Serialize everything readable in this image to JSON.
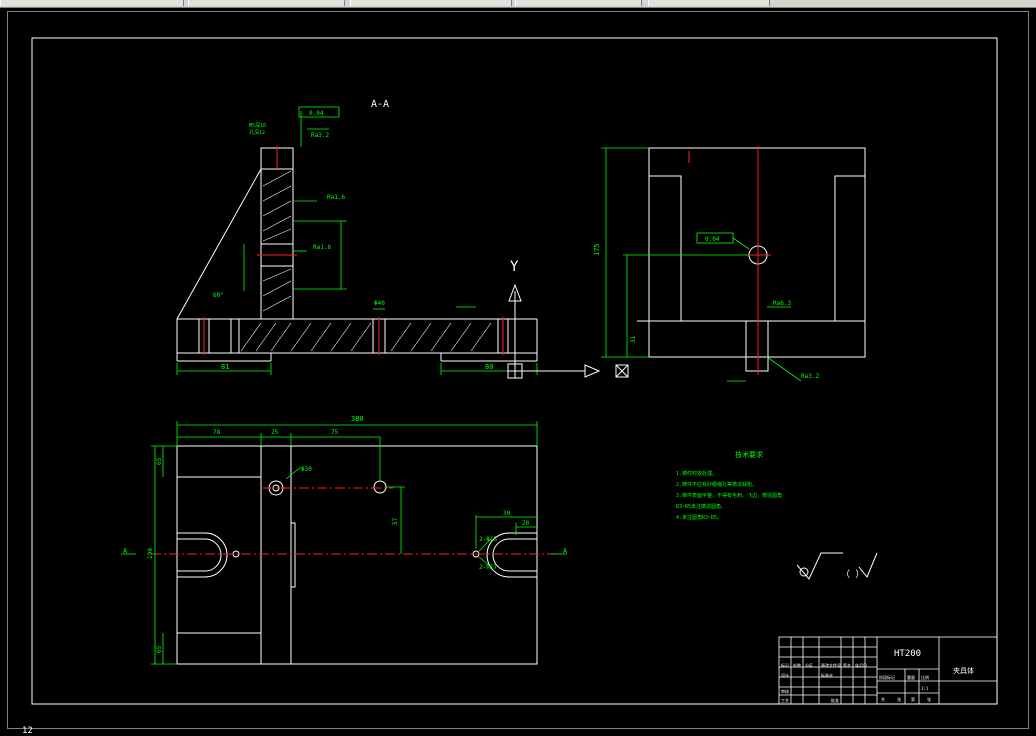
{
  "status": {
    "coord": "12"
  },
  "colors": {
    "background": "#000000",
    "linework": "#ffffff",
    "dimension": "#00ff00",
    "centerline": "#ff0000",
    "ucs": "#ffffff"
  },
  "drawing": {
    "section_title": "A-A",
    "section_mark_left": "A",
    "section_mark_right": "A",
    "axis_y_label": "Y",
    "material": "HT200",
    "part_name": "夹具体",
    "tech_req_title": "技术要求",
    "tech_reqs": [
      "1.铸件时效处理。",
      "2.铸件不应有砂眼缩孔等铸造缺陷。",
      "3.铸件表面平整，不得有毛刺、飞边，铸造圆角",
      "R3~R5未注铸造圆角。",
      "4.未注圆角R3~R5。"
    ],
    "roughness_note": "（  ）",
    "dims": {
      "overall_width": "380",
      "d78": "78",
      "d25": "25",
      "d75": "75",
      "d57": "57",
      "d30": "30",
      "d20": "20",
      "d65_top": "65",
      "d65_bottom": "65",
      "d190": "190",
      "hole_dia": "Φ30",
      "phi15": "2-Φ15",
      "r17": "2-R17",
      "d81": "81",
      "d80": "80",
      "d175": "175",
      "d31": "31",
      "d40": "Φ40",
      "ang": "60°",
      "tol1": "0.04",
      "ra32": "Ra3.2",
      "ra16a": "Ra1.6",
      "ra16b": "Ra1.6",
      "ra63": "Ra6.3",
      "ra32b": "Ra3.2",
      "m5": "M5深10",
      "hole2": "孔深12"
    },
    "title_block": {
      "r1": [
        "标记",
        "处数",
        "分区",
        "更改文件号",
        "签名",
        "年月日"
      ],
      "r2": [
        "设计",
        "",
        "标准化",
        "",
        "阶段标记",
        "重量",
        "比例"
      ],
      "r3": [
        "审核",
        "",
        "",
        "",
        "",
        "",
        "1:1"
      ],
      "r4": [
        "工艺",
        "",
        "批准",
        "",
        "共",
        "张",
        "第",
        "张"
      ]
    }
  }
}
